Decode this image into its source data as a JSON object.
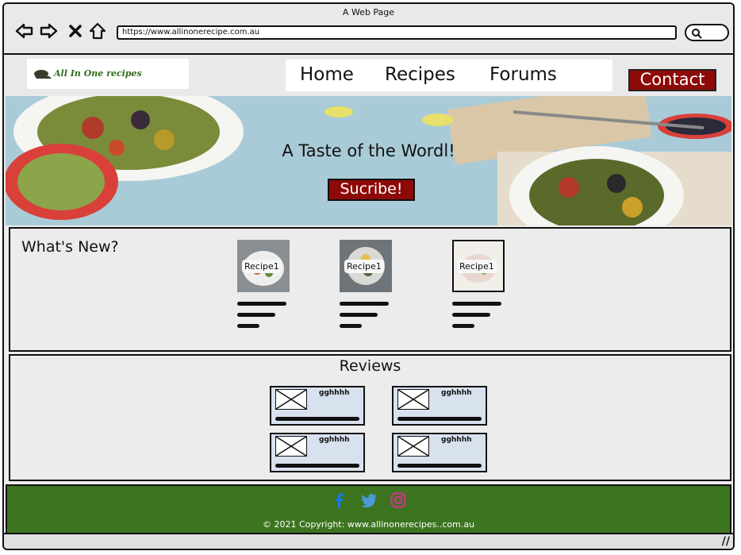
{
  "window": {
    "title": "A Web Page"
  },
  "browser": {
    "url": "https://www.allinonerecipe.com.au"
  },
  "header": {
    "logo_text": "All In  One recipes",
    "nav": [
      "Home",
      "Recipes",
      "Forums"
    ],
    "contact_label": "Contact"
  },
  "hero": {
    "title": "A Taste of the Wordl!",
    "button_label": "Sucribe!"
  },
  "whats_new": {
    "title": "What's New?",
    "recipes": [
      {
        "label": "Recipe1"
      },
      {
        "label": "Recipe1"
      },
      {
        "label": "Recipe1"
      }
    ]
  },
  "reviews": {
    "title": "Reviews",
    "cards": [
      {
        "name": "gghhhh"
      },
      {
        "name": "gghhhh"
      },
      {
        "name": "gghhhh"
      },
      {
        "name": "gghhhh"
      }
    ]
  },
  "footer": {
    "social": [
      "facebook-icon",
      "twitter-icon",
      "instagram-icon"
    ],
    "copyright": "© 2021 Copyright: www.allinonerecipes..com.au"
  },
  "colors": {
    "accent": "#8d0a08",
    "footer": "#3d7420",
    "hero": "#a9cbd7"
  }
}
